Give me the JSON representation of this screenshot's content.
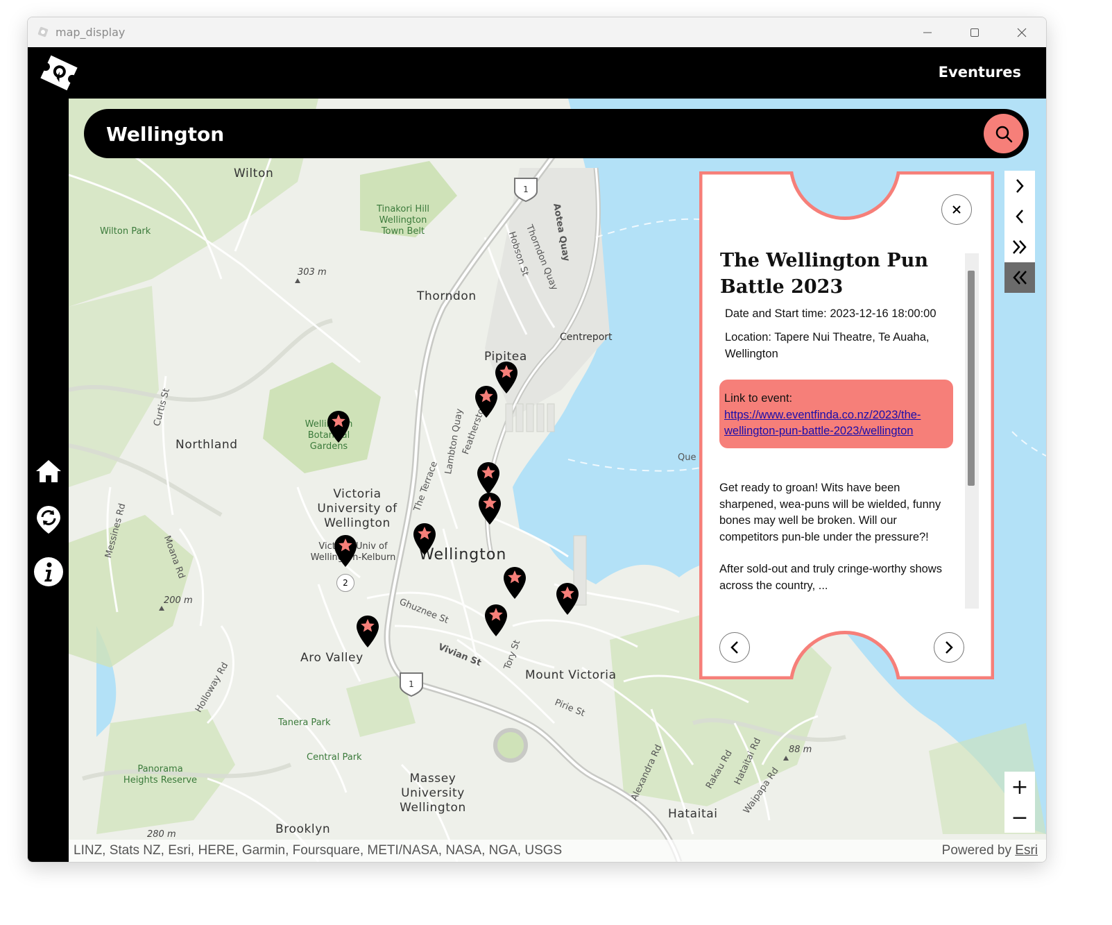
{
  "window": {
    "title": "map_display"
  },
  "header": {
    "brand": "Eventures"
  },
  "search": {
    "value": "Wellington"
  },
  "sidebar": {
    "items": [
      "home-icon",
      "refresh-location-icon",
      "info-icon"
    ]
  },
  "map": {
    "places": {
      "wilton": "Wilton",
      "wilton_park": "Wilton Park",
      "tinakori": "Tinakori Hill\nWellington\nTown Belt",
      "elev_303": "303 m",
      "thorndon": "Thorndon",
      "centreport": "Centreport",
      "pipitea": "Pipitea",
      "northland": "Northland",
      "botanical": "Wellington\nBotanical\nGardens",
      "victoria_univ": "Victoria\nUniversity of\nWellington",
      "victoria_kelburn": "Victoria Univ of\nWellington-Kelburn",
      "wellington": "Wellington",
      "elev_200": "200 m",
      "aro_valley": "Aro Valley",
      "mount_victoria": "Mount Victoria",
      "tanera": "Tanera Park",
      "central_park": "Central Park",
      "panorama": "Panorama\nHeights Reserve",
      "massey": "Massey\nUniversity\nWellington",
      "hataitai": "Hataitai",
      "brooklyn": "Brooklyn",
      "elev_280": "280 m",
      "elev_88": "88 m",
      "aotea_quay": "Aotea Quay",
      "hobson_st": "Hobson St",
      "thorndon_quay": "Thorndon Quay",
      "lambton_quay": "Lambton Quay",
      "the_terrace": "The Terrace",
      "featherston_st": "Featherston St",
      "ghuznee_st": "Ghuznee St",
      "vivian_st": "Vivian St",
      "tory_st": "Tory St",
      "pirie_st": "Pirie St",
      "curtis_st": "Curtis St",
      "messines_rd": "Messines Rd",
      "moana_rd": "Moana Rd",
      "holloway_rd": "Holloway Rd",
      "alexandra_rd": "Alexandra Rd",
      "rakau_rd": "Rakau Rd",
      "hataitai_rd": "Hataitai Rd",
      "waipapa_rd": "Waipapa Rd",
      "quays": "Que",
      "route": "1",
      "cluster_count": "2"
    },
    "zoom_in": "+",
    "zoom_out": "−",
    "attribution": "LINZ, Stats NZ, Esri, HERE, Garmin, Foursquare, METI/NASA, NASA, NGA, USGS",
    "powered_by": "Powered by",
    "esri": "Esri"
  },
  "event": {
    "title": "The Wellington Pun Battle 2023",
    "date_label": "Date and Start time: 2023-12-16 18:00:00",
    "location_label": "Location: Tapere Nui Theatre, Te Auaha, Wellington",
    "link_prefix": "Link to event: ",
    "link_url": "https://www.eventfinda.co.nz/2023/the-wellington-pun-battle-2023/wellington",
    "desc_1": "Get ready to groan! Wits have been sharpened, wea-puns will be wielded, funny bones may well be broken. Will our competitors pun-ble under the pressure?!",
    "desc_2": "After sold-out and truly cringe-worthy shows across the country, ..."
  },
  "nav": {
    "items": [
      "next-icon",
      "previous-icon",
      "last-icon",
      "first-icon"
    ]
  },
  "colors": {
    "accent": "#f67f79",
    "header": "#000000",
    "water": "#b3e1f7",
    "land": "#eef0ea",
    "park": "#cfe2b8"
  }
}
